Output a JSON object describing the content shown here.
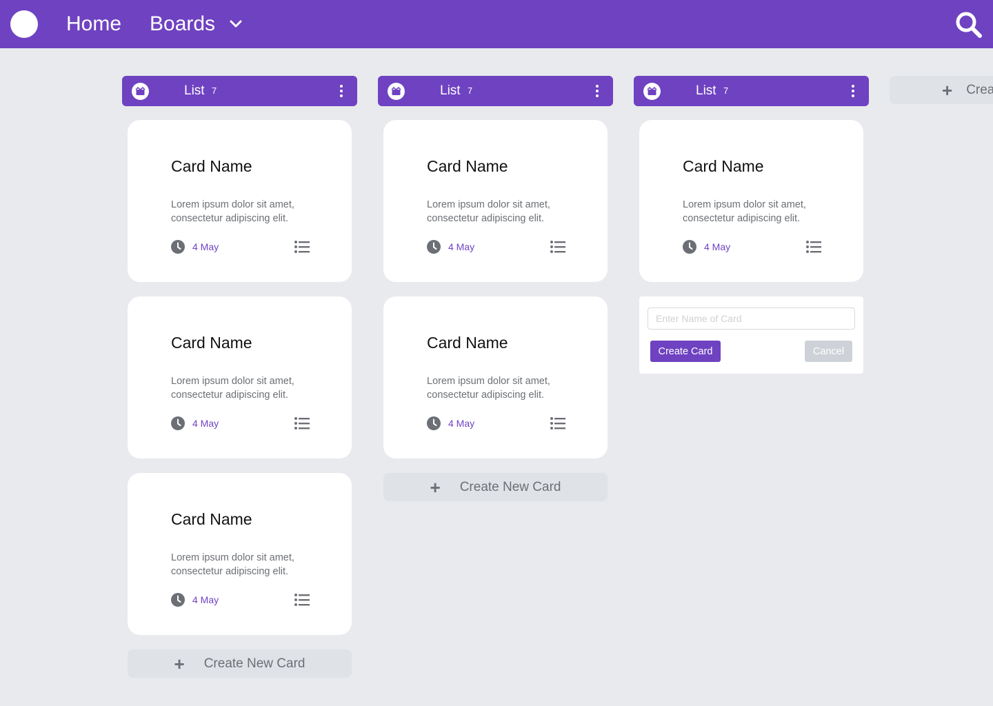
{
  "topbar": {
    "home_label": "Home",
    "boards_label": "Boards"
  },
  "lists": [
    {
      "title": "List",
      "count": "7",
      "cards": [
        {
          "name": "Card Name",
          "desc": "Lorem ipsum dolor sit amet, consectetur adipiscing elit.",
          "date": "4 May"
        },
        {
          "name": "Card Name",
          "desc": "Lorem ipsum dolor sit amet, consectetur adipiscing elit.",
          "date": "4 May"
        },
        {
          "name": "Card Name",
          "desc": "Lorem ipsum dolor sit amet, consectetur adipiscing elit.",
          "date": "4 May"
        }
      ],
      "create_label": "Create New Card"
    },
    {
      "title": "List",
      "count": "7",
      "cards": [
        {
          "name": "Card Name",
          "desc": "Lorem ipsum dolor sit amet, consectetur adipiscing elit.",
          "date": "4 May"
        },
        {
          "name": "Card Name",
          "desc": "Lorem ipsum dolor sit amet, consectetur adipiscing elit.",
          "date": "4 May"
        }
      ],
      "create_label": "Create New Card"
    },
    {
      "title": "List",
      "count": "7",
      "cards": [
        {
          "name": "Card Name",
          "desc": "Lorem ipsum dolor sit amet, consectetur adipiscing elit.",
          "date": "4 May"
        }
      ],
      "add_form": {
        "placeholder": "Enter Name of Card",
        "value": "",
        "create_label": "Create Card",
        "cancel_label": "Cancel"
      }
    }
  ],
  "create_list_label": "Create",
  "colors": {
    "accent": "#6f42c1",
    "background": "#e8eaee",
    "muted": "#6c6f75"
  }
}
